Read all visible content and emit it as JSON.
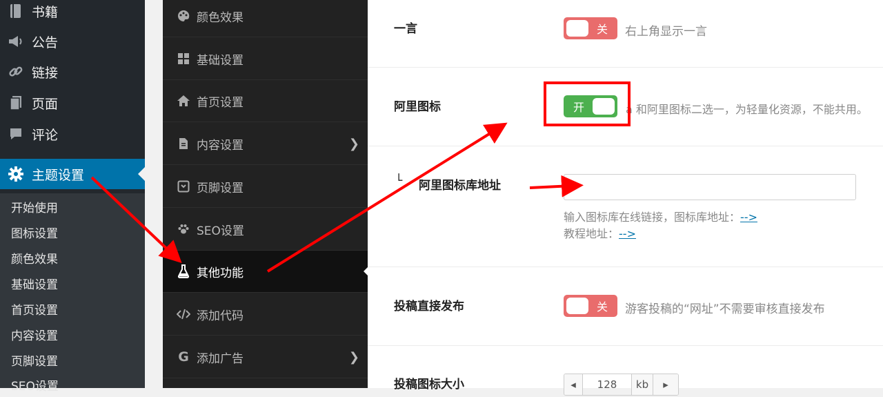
{
  "wp_menu": [
    {
      "label": "书籍",
      "icon": "book-icon"
    },
    {
      "label": "公告",
      "icon": "megaphone-icon"
    },
    {
      "label": "链接",
      "icon": "link-icon"
    },
    {
      "label": "页面",
      "icon": "pages-icon"
    },
    {
      "label": "评论",
      "icon": "comment-icon"
    },
    {
      "label": "主题设置",
      "icon": "gear-icon"
    }
  ],
  "wp_submenu": [
    "开始使用",
    "图标设置",
    "颜色效果",
    "基础设置",
    "首页设置",
    "内容设置",
    "页脚设置",
    "SEO设置"
  ],
  "option_nav": [
    {
      "label": "颜色效果",
      "icon": "palette-icon"
    },
    {
      "label": "基础设置",
      "icon": "grid-icon"
    },
    {
      "label": "首页设置",
      "icon": "home-icon"
    },
    {
      "label": "内容设置",
      "icon": "document-icon"
    },
    {
      "label": "页脚设置",
      "icon": "footer-icon"
    },
    {
      "label": "SEO设置",
      "icon": "paw-icon"
    },
    {
      "label": "其他功能",
      "icon": "flask-icon"
    },
    {
      "label": "添加代码",
      "icon": "code-icon"
    },
    {
      "label": "添加广告",
      "icon": "google-icon"
    }
  ],
  "options": {
    "yiyan": {
      "label": "一言",
      "switch": "关",
      "help": "右上角显示一言"
    },
    "ali_icon": {
      "label": "阿里图标",
      "switch": "开",
      "help": "a 和阿里图标二选一，为轻量化资源，不能共用。"
    },
    "ali_icon_url": {
      "prefix": "└",
      "label": "阿里图标库地址",
      "value": "",
      "help1": "输入图标库在线链接，图标库地址：",
      "help1_link": "-->",
      "help2": "教程地址：",
      "help2_link": "-->"
    },
    "post_direct": {
      "label": "投稿直接发布",
      "switch": "关",
      "help": "游客投稿的“网址”不需要审核直接发布"
    },
    "post_icon_size": {
      "label": "投稿图标大小",
      "value": "128",
      "unit": "kb",
      "dec": "◂",
      "inc": "▸"
    }
  },
  "colors": {
    "wp_active": "#0073aa",
    "switch_on": "#4cb04f",
    "switch_off": "#e96c6c",
    "annotation": "#ff0000"
  }
}
